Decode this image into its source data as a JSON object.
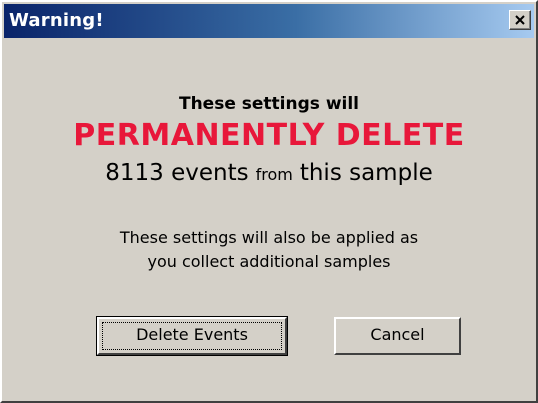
{
  "window": {
    "title": "Warning!"
  },
  "message": {
    "line1": "These settings will",
    "line2": "PERMANENTLY DELETE",
    "count_phrase": "8113 events",
    "from_word": "from",
    "sample_phrase": "this sample",
    "note_line1": "These settings will also be applied as",
    "note_line2": "you collect additional samples"
  },
  "buttons": {
    "delete_label": "Delete Events",
    "cancel_label": "Cancel"
  },
  "icons": {
    "close": "close-icon"
  },
  "colors": {
    "warning_text": "#e8173a",
    "titlebar_start": "#0a246a",
    "titlebar_end": "#a6caf0",
    "face": "#d4d0c8"
  }
}
